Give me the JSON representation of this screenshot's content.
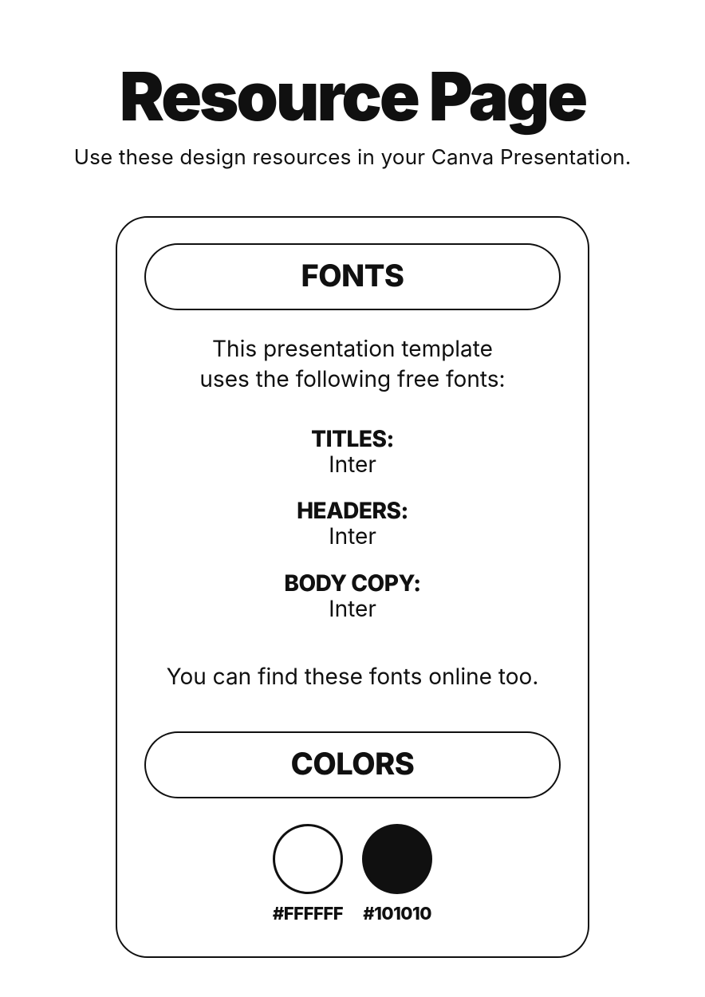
{
  "title": "Resource Page",
  "subtitle": "Use these design resources in your Canva Presentation.",
  "fonts": {
    "header": "FONTS",
    "intro_line1": "This presentation template",
    "intro_line2": "uses the following free fonts:",
    "items": [
      {
        "label": "TITLES:",
        "value": "Inter"
      },
      {
        "label": "HEADERS:",
        "value": "Inter"
      },
      {
        "label": "BODY COPY:",
        "value": "Inter"
      }
    ],
    "footnote": "You can find these fonts online too."
  },
  "colors": {
    "header": "COLORS",
    "swatches": [
      {
        "hex": "#FFFFFF",
        "class": "swatch-white"
      },
      {
        "hex": "#101010",
        "class": "swatch-black"
      }
    ]
  }
}
